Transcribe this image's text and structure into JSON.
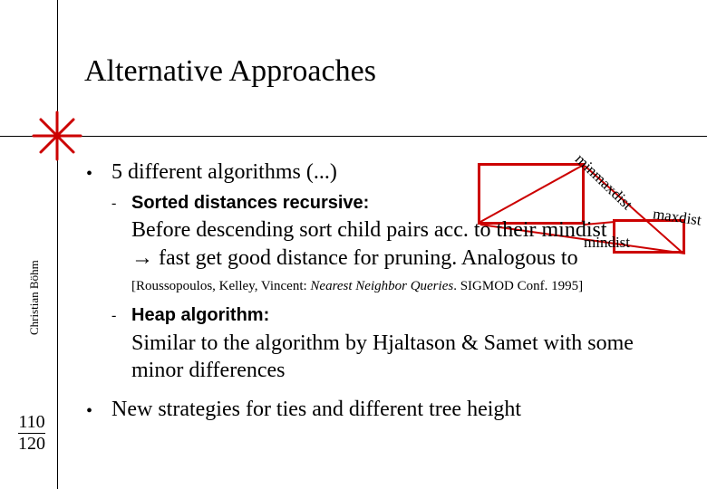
{
  "title": "Alternative Approaches",
  "author": "Christian Böhm",
  "page": {
    "current": "110",
    "total": "120"
  },
  "diagram": {
    "minmax": "minmaxdist",
    "maxdist": "maxdist",
    "mindist": "mindist"
  },
  "bullets": {
    "b1": "5 different algorithms (...)",
    "b2": "New strategies for ties and different tree height"
  },
  "items": {
    "sorted": {
      "heading": "Sorted distances recursive:",
      "body1": "Before descending sort child pairs acc. to their mindist",
      "body2": " fast get good distance for pruning. Analogous to"
    },
    "citation": "[Roussopoulos, Kelley, Vincent: Nearest Neighbor Queries. SIGMOD Conf. 1995]",
    "heap": {
      "heading": "Heap algorithm:",
      "body": "Similar to the algorithm by Hjaltason & Samet with some minor differences"
    }
  },
  "glyphs": {
    "arrow": "→"
  }
}
